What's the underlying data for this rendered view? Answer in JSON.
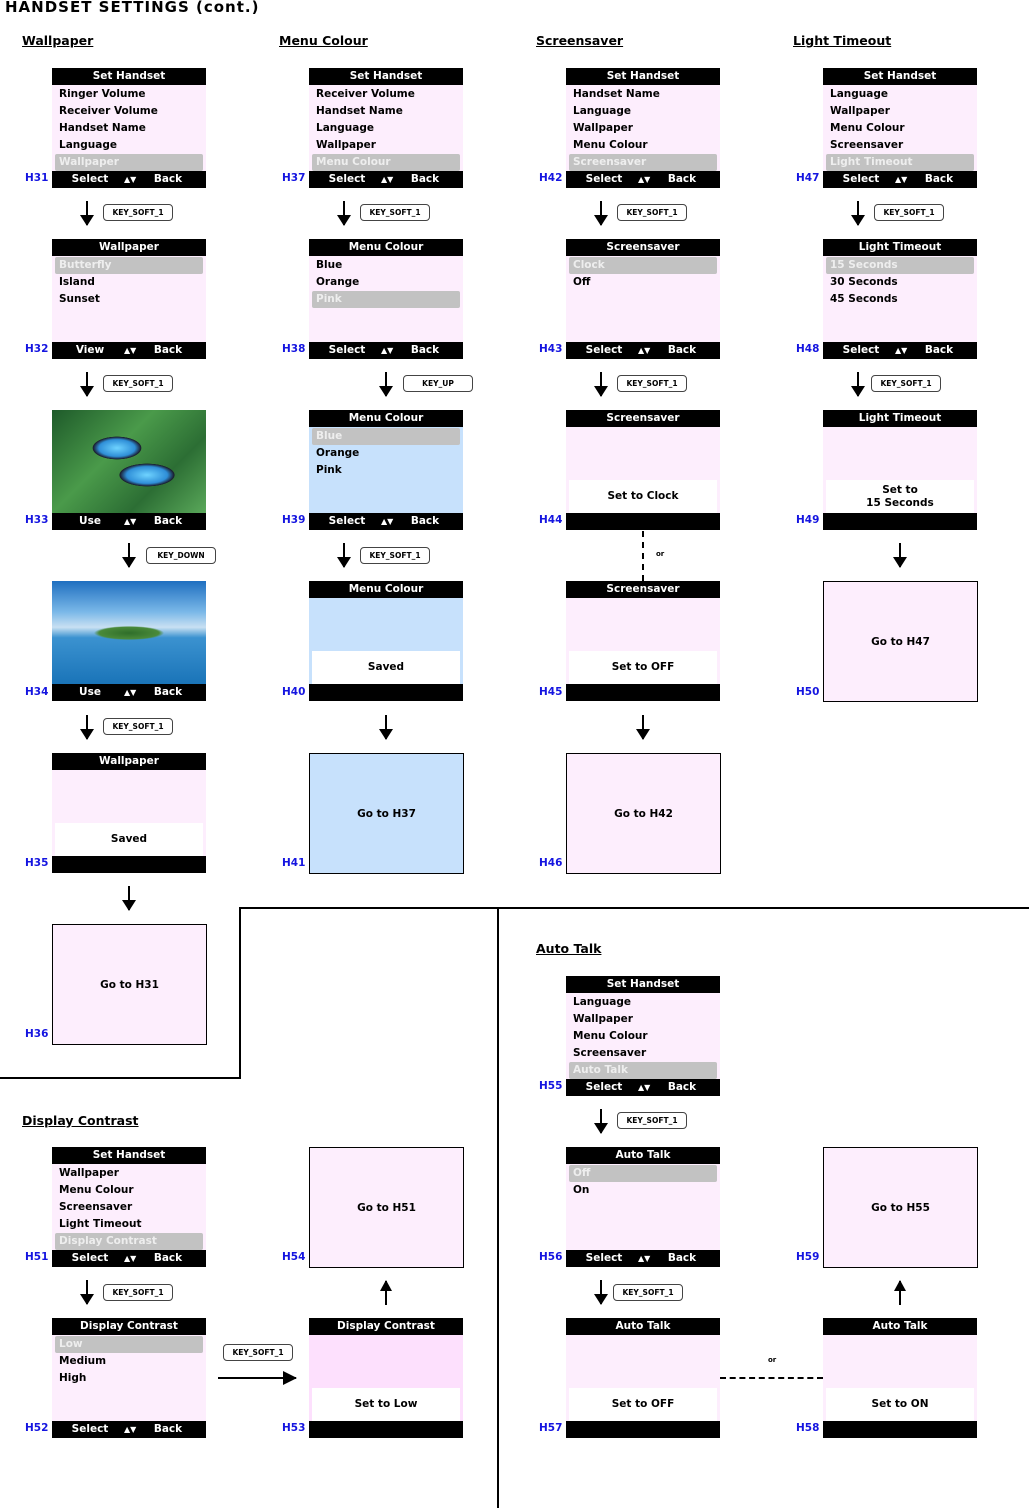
{
  "page_title": "HANDSET SETTINGS (cont.)",
  "connector_or": "or",
  "sections": {
    "wallpaper": "Wallpaper",
    "menu_colour": "Menu Colour",
    "screensaver": "Screensaver",
    "light_timeout": "Light Timeout",
    "display_contrast": "Display Contrast",
    "auto_talk": "Auto Talk"
  },
  "softkeys": {
    "select": "Select",
    "back": "Back",
    "view": "View",
    "use": "Use"
  },
  "keys": {
    "soft1": "KEY_SOFT_1",
    "down": "KEY_DOWN",
    "up": "KEY_UP"
  },
  "screens": {
    "H31": {
      "id": "H31",
      "title": "Set Handset",
      "items": [
        "Ringer Volume",
        "Receiver Volume",
        "Handset Name",
        "Language",
        "Wallpaper"
      ],
      "selected": 4
    },
    "H32": {
      "id": "H32",
      "title": "Wallpaper",
      "items": [
        "Butterfly",
        "Island",
        "Sunset"
      ],
      "selected": 0
    },
    "H33": {
      "id": "H33",
      "image": "butterfly-wallpaper"
    },
    "H34": {
      "id": "H34",
      "image": "island-wallpaper"
    },
    "H35": {
      "id": "H35",
      "title": "Wallpaper",
      "message": "Saved"
    },
    "H36": {
      "id": "H36",
      "goto": "Go to H31"
    },
    "H37": {
      "id": "H37",
      "title": "Set Handset",
      "items": [
        "Receiver Volume",
        "Handset Name",
        "Language",
        "Wallpaper",
        "Menu Colour"
      ],
      "selected": 4
    },
    "H38": {
      "id": "H38",
      "title": "Menu Colour",
      "items": [
        "Blue",
        "Orange",
        "Pink"
      ],
      "selected": 2
    },
    "H39": {
      "id": "H39",
      "title": "Menu Colour",
      "items": [
        "Blue",
        "Orange",
        "Pink"
      ],
      "selected": 0
    },
    "H40": {
      "id": "H40",
      "title": "Menu Colour",
      "message": "Saved"
    },
    "H41": {
      "id": "H41",
      "goto": "Go to H37"
    },
    "H42": {
      "id": "H42",
      "title": "Set Handset",
      "items": [
        "Handset Name",
        "Language",
        "Wallpaper",
        "Menu Colour",
        "Screensaver"
      ],
      "selected": 4
    },
    "H43": {
      "id": "H43",
      "title": "Screensaver",
      "items": [
        "Clock",
        "Off"
      ],
      "selected": 0
    },
    "H44": {
      "id": "H44",
      "title": "Screensaver",
      "message": "Set to Clock"
    },
    "H45": {
      "id": "H45",
      "title": "Screensaver",
      "message": "Set to OFF"
    },
    "H46": {
      "id": "H46",
      "goto": "Go to H42"
    },
    "H47": {
      "id": "H47",
      "title": "Set Handset",
      "items": [
        "Language",
        "Wallpaper",
        "Menu Colour",
        "Screensaver",
        "Light Timeout"
      ],
      "selected": 4
    },
    "H48": {
      "id": "H48",
      "title": "Light Timeout",
      "items": [
        "15 Seconds",
        "30 Seconds",
        "45 Seconds"
      ],
      "selected": 0
    },
    "H49": {
      "id": "H49",
      "title": "Light Timeout",
      "message_line1": "Set to",
      "message_line2": "15 Seconds"
    },
    "H50": {
      "id": "H50",
      "goto": "Go to H47"
    },
    "H51": {
      "id": "H51",
      "title": "Set Handset",
      "items": [
        "Wallpaper",
        "Menu Colour",
        "Screensaver",
        "Light Timeout",
        "Display Contrast"
      ],
      "selected": 4
    },
    "H52": {
      "id": "H52",
      "title": "Display Contrast",
      "items": [
        "Low",
        "Medium",
        "High"
      ],
      "selected": 0
    },
    "H53": {
      "id": "H53",
      "title": "Display Contrast",
      "message": "Set to Low"
    },
    "H54": {
      "id": "H54",
      "goto": "Go to H51"
    },
    "H55": {
      "id": "H55",
      "title": "Set Handset",
      "items": [
        "Language",
        "Wallpaper",
        "Menu Colour",
        "Screensaver",
        "Auto Talk"
      ],
      "selected": 4
    },
    "H56": {
      "id": "H56",
      "title": "Auto Talk",
      "items": [
        "Off",
        "On"
      ],
      "selected": 0
    },
    "H57": {
      "id": "H57",
      "title": "Auto Talk",
      "message": "Set to OFF"
    },
    "H58": {
      "id": "H58",
      "title": "Auto Talk",
      "message": "Set to ON"
    },
    "H59": {
      "id": "H59",
      "goto": "Go to H55"
    }
  },
  "colors": {
    "pink_bg": "#fdeefd",
    "blue_bg": "#c7e1fc",
    "selected_bg": "#c2c2c2",
    "label_blue": "#1515e0"
  }
}
